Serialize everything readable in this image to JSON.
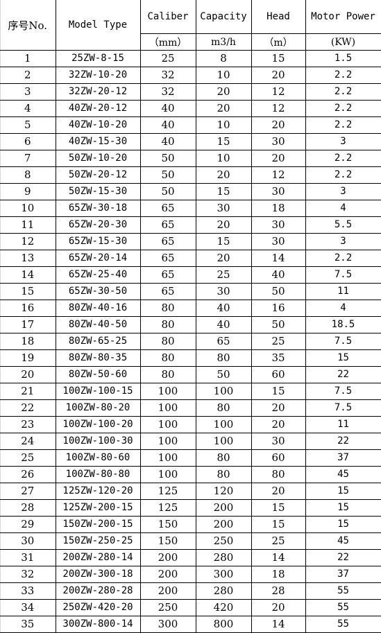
{
  "table": {
    "headers": {
      "no": "序号No.",
      "model": "Model Type",
      "caliber": "Caliber",
      "capacity": "Capacity",
      "head": "Head",
      "power": "Motor Power"
    },
    "units": {
      "caliber": "（mm）",
      "capacity": "m3/h",
      "head": "（m）",
      "power": "(KW)"
    },
    "rows": [
      {
        "no": "1",
        "model": "25ZW-8-15",
        "caliber": "25",
        "capacity": "8",
        "head": "15",
        "power": "1.5"
      },
      {
        "no": "2",
        "model": "32ZW-10-20",
        "caliber": "32",
        "capacity": "10",
        "head": "20",
        "power": "2.2"
      },
      {
        "no": "3",
        "model": "32ZW-20-12",
        "caliber": "32",
        "capacity": "20",
        "head": "12",
        "power": "2.2"
      },
      {
        "no": "4",
        "model": "40ZW-20-12",
        "caliber": "40",
        "capacity": "20",
        "head": "12",
        "power": "2.2"
      },
      {
        "no": "5",
        "model": "40ZW-10-20",
        "caliber": "40",
        "capacity": "10",
        "head": "20",
        "power": "2.2"
      },
      {
        "no": "6",
        "model": "40ZW-15-30",
        "caliber": "40",
        "capacity": "15",
        "head": "30",
        "power": "3"
      },
      {
        "no": "7",
        "model": "50ZW-10-20",
        "caliber": "50",
        "capacity": "10",
        "head": "20",
        "power": "2.2"
      },
      {
        "no": "8",
        "model": "50ZW-20-12",
        "caliber": "50",
        "capacity": "20",
        "head": "12",
        "power": "2.2"
      },
      {
        "no": "9",
        "model": "50ZW-15-30",
        "caliber": "50",
        "capacity": "15",
        "head": "30",
        "power": "3"
      },
      {
        "no": "10",
        "model": "65ZW-30-18",
        "caliber": "65",
        "capacity": "30",
        "head": "18",
        "power": "4"
      },
      {
        "no": "11",
        "model": "65ZW-20-30",
        "caliber": "65",
        "capacity": "20",
        "head": "30",
        "power": "5.5"
      },
      {
        "no": "12",
        "model": "65ZW-15-30",
        "caliber": "65",
        "capacity": "15",
        "head": "30",
        "power": "3"
      },
      {
        "no": "13",
        "model": "65ZW-20-14",
        "caliber": "65",
        "capacity": "20",
        "head": "14",
        "power": "2.2"
      },
      {
        "no": "14",
        "model": "65ZW-25-40",
        "caliber": "65",
        "capacity": "25",
        "head": "40",
        "power": "7.5"
      },
      {
        "no": "15",
        "model": "65ZW-30-50",
        "caliber": "65",
        "capacity": "30",
        "head": "50",
        "power": "11"
      },
      {
        "no": "16",
        "model": "80ZW-40-16",
        "caliber": "80",
        "capacity": "40",
        "head": "16",
        "power": "4"
      },
      {
        "no": "17",
        "model": "80ZW-40-50",
        "caliber": "80",
        "capacity": "40",
        "head": "50",
        "power": "18.5"
      },
      {
        "no": "18",
        "model": "80ZW-65-25",
        "caliber": "80",
        "capacity": "65",
        "head": "25",
        "power": "7.5"
      },
      {
        "no": "19",
        "model": "80ZW-80-35",
        "caliber": "80",
        "capacity": "80",
        "head": "35",
        "power": "15"
      },
      {
        "no": "20",
        "model": "80ZW-50-60",
        "caliber": "80",
        "capacity": "50",
        "head": "60",
        "power": "22"
      },
      {
        "no": "21",
        "model": "100ZW-100-15",
        "caliber": "100",
        "capacity": "100",
        "head": "15",
        "power": "7.5"
      },
      {
        "no": "22",
        "model": "100ZW-80-20",
        "caliber": "100",
        "capacity": "80",
        "head": "20",
        "power": "7.5"
      },
      {
        "no": "23",
        "model": "100ZW-100-20",
        "caliber": "100",
        "capacity": "100",
        "head": "20",
        "power": "11"
      },
      {
        "no": "24",
        "model": "100ZW-100-30",
        "caliber": "100",
        "capacity": "100",
        "head": "30",
        "power": "22"
      },
      {
        "no": "25",
        "model": "100ZW-80-60",
        "caliber": "100",
        "capacity": "80",
        "head": "60",
        "power": "37"
      },
      {
        "no": "26",
        "model": "100ZW-80-80",
        "caliber": "100",
        "capacity": "80",
        "head": "80",
        "power": "45"
      },
      {
        "no": "27",
        "model": "125ZW-120-20",
        "caliber": "125",
        "capacity": "120",
        "head": "20",
        "power": "15"
      },
      {
        "no": "28",
        "model": "125ZW-200-15",
        "caliber": "125",
        "capacity": "200",
        "head": "15",
        "power": "15"
      },
      {
        "no": "29",
        "model": "150ZW-200-15",
        "caliber": "150",
        "capacity": "200",
        "head": "15",
        "power": "15"
      },
      {
        "no": "30",
        "model": "150ZW-250-25",
        "caliber": "150",
        "capacity": "250",
        "head": "25",
        "power": "45"
      },
      {
        "no": "31",
        "model": "200ZW-280-14",
        "caliber": "200",
        "capacity": "280",
        "head": "14",
        "power": "22"
      },
      {
        "no": "32",
        "model": "200ZW-300-18",
        "caliber": "200",
        "capacity": "300",
        "head": "18",
        "power": "37"
      },
      {
        "no": "33",
        "model": "200ZW-280-28",
        "caliber": "200",
        "capacity": "280",
        "head": "28",
        "power": "55"
      },
      {
        "no": "34",
        "model": "250ZW-420-20",
        "caliber": "250",
        "capacity": "420",
        "head": "20",
        "power": "55"
      },
      {
        "no": "35",
        "model": "300ZW-800-14",
        "caliber": "300",
        "capacity": "800",
        "head": "14",
        "power": "55"
      }
    ]
  }
}
